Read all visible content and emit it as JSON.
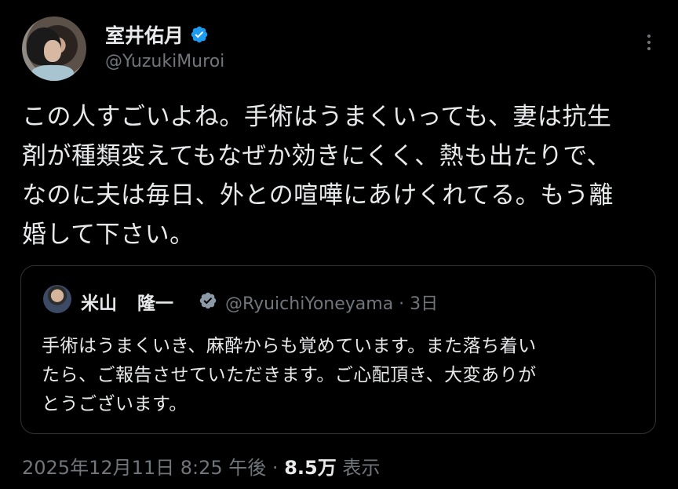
{
  "author": {
    "display_name": "室井佑月",
    "handle": "@YuzukiMuroi"
  },
  "tweet": {
    "lines": [
      "この人すごいよね。手術はうまくいっても、妻は抗生",
      "剤が種類変えてもなぜか効きにくく、熱も出たりで、",
      "なのに夫は毎日、外との喧嘩にあけくれてる。もう離",
      "婚して下さい。"
    ]
  },
  "quoted_tweet": {
    "name_part1": "米山",
    "name_part2": "隆一",
    "handle_time": "@RyuichiYoneyama · 3日",
    "lines": [
      "手術はうまくいき、麻酔からも覚めています。また落ち着い",
      "たら、ご報告させていただきます。ご心配頂き、大変ありが",
      "とうございます。"
    ]
  },
  "meta": {
    "timestamp": "2025年12月11日 8:25 午後 · ",
    "views_count": "8.5万",
    "views_label": " 表示"
  },
  "colors": {
    "background": "#000000",
    "text": "#e7e9ea",
    "secondary": "#71767b",
    "verified": "#1d9bf0",
    "border": "#2f3336"
  },
  "icons": [
    "verified-badge-icon",
    "more-options-icon"
  ]
}
